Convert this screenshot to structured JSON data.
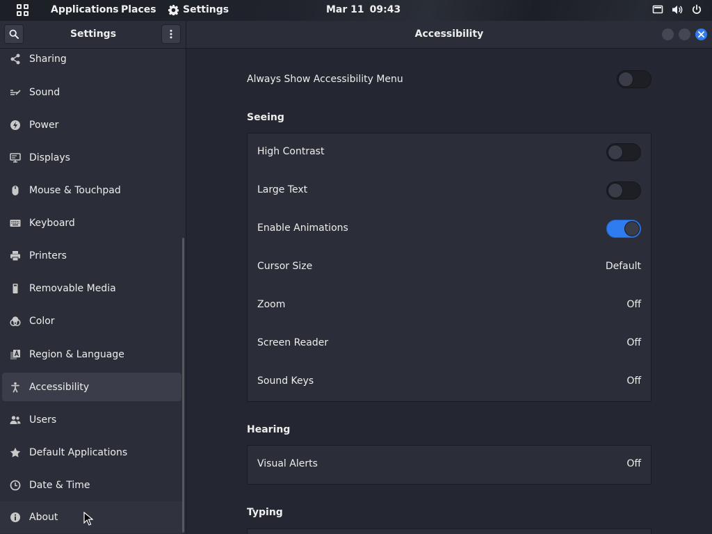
{
  "topbar": {
    "applications": "Applications",
    "places": "Places",
    "app_name": "Settings",
    "date": "Mar 11",
    "time": "09:43"
  },
  "window": {
    "sidebar_title": "Settings",
    "panel_title": "Accessibility"
  },
  "sidebar": {
    "items": [
      {
        "label": "Sharing",
        "icon": "share-icon"
      },
      {
        "label": "Sound",
        "icon": "sound-icon"
      },
      {
        "label": "Power",
        "icon": "power-icon"
      },
      {
        "label": "Displays",
        "icon": "display-icon"
      },
      {
        "label": "Mouse & Touchpad",
        "icon": "mouse-icon"
      },
      {
        "label": "Keyboard",
        "icon": "keyboard-icon"
      },
      {
        "label": "Printers",
        "icon": "printer-icon"
      },
      {
        "label": "Removable Media",
        "icon": "removable-media-icon"
      },
      {
        "label": "Color",
        "icon": "color-icon"
      },
      {
        "label": "Region & Language",
        "icon": "region-language-icon"
      },
      {
        "label": "Accessibility",
        "icon": "accessibility-icon",
        "active": true
      },
      {
        "label": "Users",
        "icon": "users-icon"
      },
      {
        "label": "Default Applications",
        "icon": "star-icon"
      },
      {
        "label": "Date & Time",
        "icon": "clock-icon"
      },
      {
        "label": "About",
        "icon": "info-icon"
      }
    ]
  },
  "content": {
    "always_show_menu": {
      "label": "Always Show Accessibility Menu",
      "on": false
    },
    "seeing": {
      "heading": "Seeing",
      "rows": [
        {
          "label": "High Contrast",
          "toggle": false
        },
        {
          "label": "Large Text",
          "toggle": false
        },
        {
          "label": "Enable Animations",
          "toggle": true
        },
        {
          "label": "Cursor Size",
          "value": "Default"
        },
        {
          "label": "Zoom",
          "value": "Off"
        },
        {
          "label": "Screen Reader",
          "value": "Off"
        },
        {
          "label": "Sound Keys",
          "value": "Off"
        }
      ]
    },
    "hearing": {
      "heading": "Hearing",
      "rows": [
        {
          "label": "Visual Alerts",
          "value": "Off"
        }
      ]
    },
    "typing": {
      "heading": "Typing"
    }
  },
  "colors": {
    "accent": "#2f7bf0",
    "sidebar_bg": "#2b2e39",
    "content_bg": "#242731"
  }
}
